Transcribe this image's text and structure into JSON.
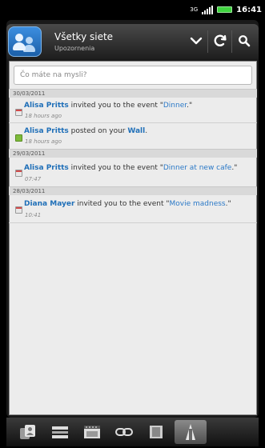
{
  "status_bar": {
    "network": "3G",
    "clock": "16:41"
  },
  "header": {
    "title": "Všetky siete",
    "subtitle": "Upozornenia"
  },
  "compose": {
    "placeholder": "Čo máte na mysli?"
  },
  "feed": [
    {
      "date": "30/03/2011",
      "items": [
        {
          "name": "Alisa Pritts",
          "text": " invited you to the event \"",
          "link": "Dinner",
          "end": ".\"",
          "time": "18 hours ago",
          "icon": "event-icon"
        },
        {
          "name": "Alisa Pritts",
          "text": " posted on your ",
          "link": "Wall",
          "end": ".",
          "time": "18 hours ago",
          "icon": "wall-post-icon"
        }
      ]
    },
    {
      "date": "29/03/2011",
      "items": [
        {
          "name": "Alisa Pritts",
          "text": " invited you to the event \"",
          "link": "Dinner at new cafe",
          "end": ".\"",
          "time": "07:47",
          "icon": "event-icon"
        }
      ]
    },
    {
      "date": "28/03/2011",
      "items": [
        {
          "name": "Diana Mayer",
          "text": " invited you to the event \"",
          "link": "Movie madness",
          "end": ".\"",
          "time": "10:41",
          "icon": "event-icon"
        }
      ]
    }
  ],
  "tabs": [
    {
      "icon": "social-networks-icon",
      "active": false
    },
    {
      "icon": "updates-icon",
      "active": false
    },
    {
      "icon": "photos-icon",
      "active": false
    },
    {
      "icon": "links-icon",
      "active": false
    },
    {
      "icon": "albums-icon",
      "active": false
    },
    {
      "icon": "notifications-icon",
      "active": true
    }
  ],
  "colors": {
    "name_blue": "#1f6fb8",
    "link_blue": "#2b79c7",
    "header_dark": "#1e1e1e"
  }
}
